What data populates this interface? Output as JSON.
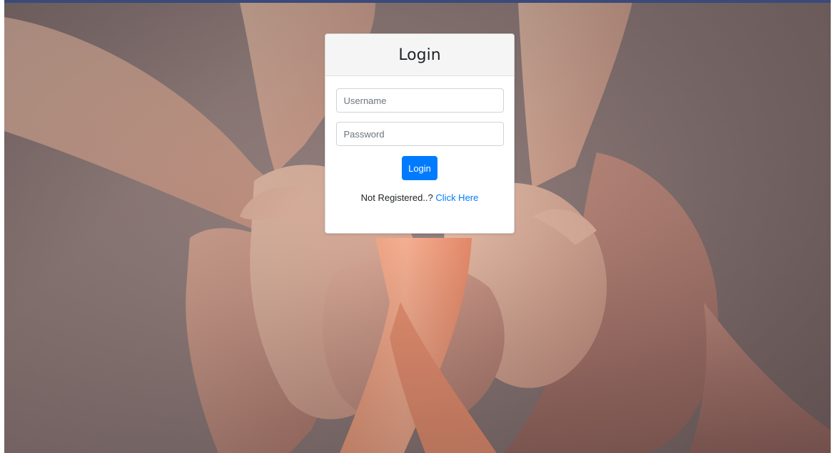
{
  "background": {
    "image": "hands-holding-orange-ribbon-photo",
    "ribbon_color": "#f4956f"
  },
  "login": {
    "title": "Login",
    "username_placeholder": "Username",
    "password_placeholder": "Password",
    "submit_label": "Login",
    "register_prompt": "Not Registered..?",
    "register_link": "Click Here"
  },
  "colors": {
    "primary": "#007bff",
    "header_bg": "#f5f5f5"
  }
}
